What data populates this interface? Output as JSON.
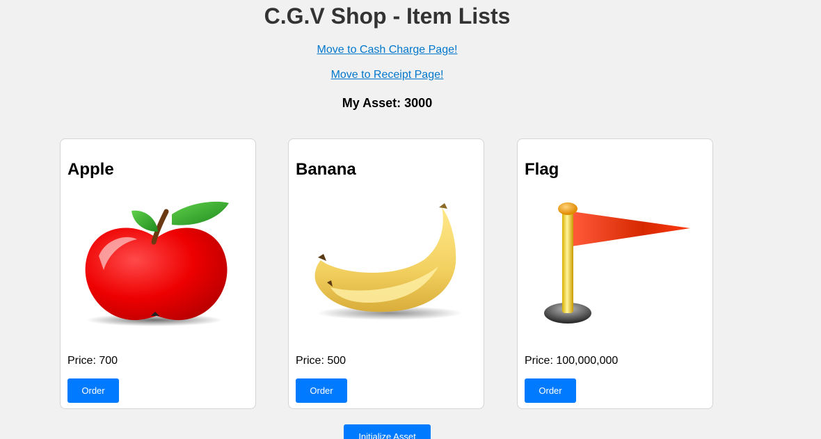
{
  "header": {
    "title": "C.G.V Shop - Item Lists"
  },
  "links": {
    "cash_charge": "Move to Cash Charge Page!",
    "receipt": "Move to Receipt Page!"
  },
  "asset": {
    "text": "My Asset: 3000"
  },
  "items": [
    {
      "name": "Apple",
      "price_text": "Price: 700",
      "order_label": "Order",
      "icon": "apple-icon"
    },
    {
      "name": "Banana",
      "price_text": "Price: 500",
      "order_label": "Order",
      "icon": "banana-icon"
    },
    {
      "name": "Flag",
      "price_text": "Price: 100,000,000",
      "order_label": "Order",
      "icon": "flag-icon"
    }
  ],
  "actions": {
    "initialize_label": "Initialize Asset"
  },
  "colors": {
    "background": "#f1f1f1",
    "button": "#007bff",
    "link": "#0077cc"
  }
}
